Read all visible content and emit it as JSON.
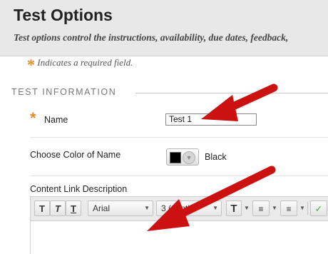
{
  "header": {
    "title": "Test Options",
    "description": "Test options control the instructions, availability, due dates, feedback,"
  },
  "required_note": {
    "symbol": "*",
    "text": "Indicates a required field."
  },
  "section": {
    "title": "TEST INFORMATION"
  },
  "name_field": {
    "label": "Name",
    "value": "Test 1"
  },
  "color_field": {
    "label": "Choose Color of Name",
    "swatch_color": "#000000",
    "color_name": "Black"
  },
  "content_link": {
    "label": "Content Link Description",
    "toolbar": {
      "font_family": "Arial",
      "font_size": "3 (12pt)"
    }
  },
  "colors": {
    "accent_orange": "#e58a1f",
    "arrow_red": "#cc1111"
  }
}
